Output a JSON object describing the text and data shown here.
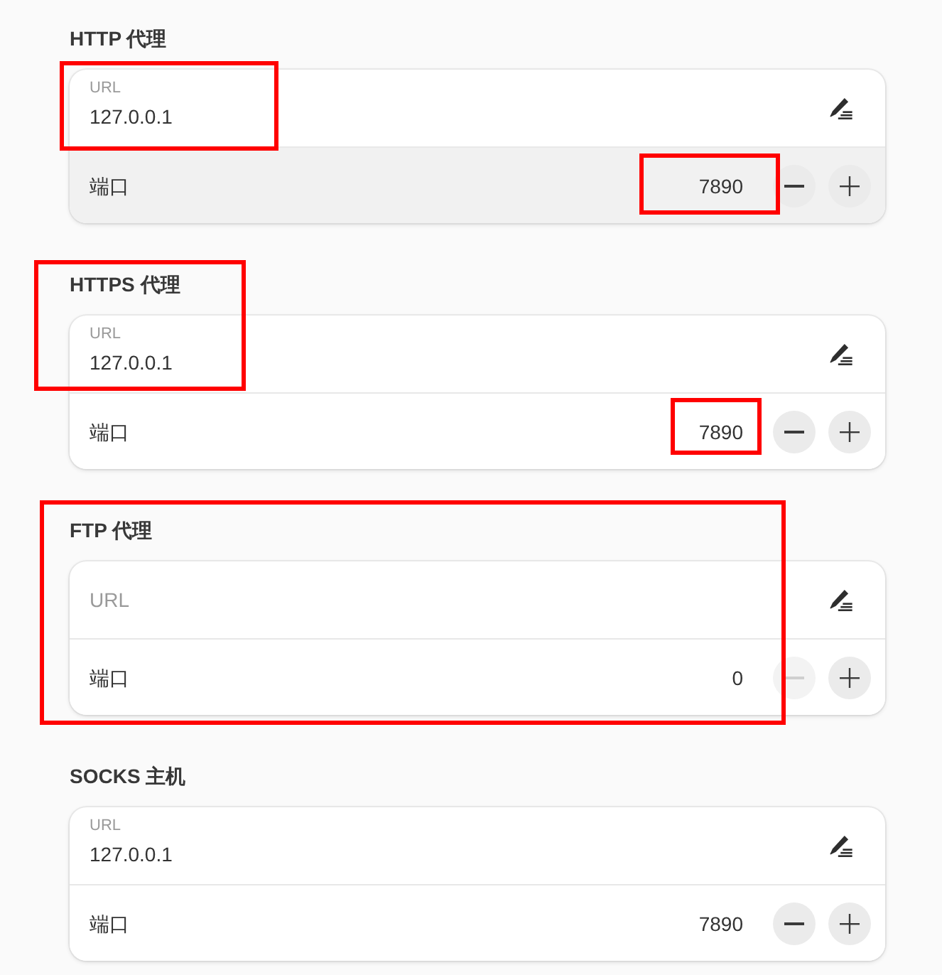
{
  "sections": [
    {
      "title": "HTTP 代理",
      "url": {
        "label": "URL",
        "value": "127.0.0.1"
      },
      "port": {
        "label": "端口",
        "value": "7890",
        "hovered": true,
        "decrement_disabled": false
      },
      "annotations": [
        {
          "kind": "url"
        },
        {
          "kind": "port-minus"
        }
      ]
    },
    {
      "title": "HTTPS 代理",
      "url": {
        "label": "URL",
        "value": "127.0.0.1"
      },
      "port": {
        "label": "端口",
        "value": "7890",
        "hovered": false,
        "decrement_disabled": false
      },
      "annotations": [
        {
          "kind": "heading-url"
        },
        {
          "kind": "port"
        }
      ]
    },
    {
      "title": "FTP 代理",
      "url": {
        "label": "URL"
      },
      "port": {
        "label": "端口",
        "value": "0",
        "hovered": false,
        "decrement_disabled": true
      },
      "annotations": [
        {
          "kind": "section"
        }
      ]
    },
    {
      "title": "SOCKS 主机",
      "url": {
        "label": "URL",
        "value": "127.0.0.1"
      },
      "port": {
        "label": "端口",
        "value": "7890",
        "hovered": false,
        "decrement_disabled": false
      }
    }
  ]
}
